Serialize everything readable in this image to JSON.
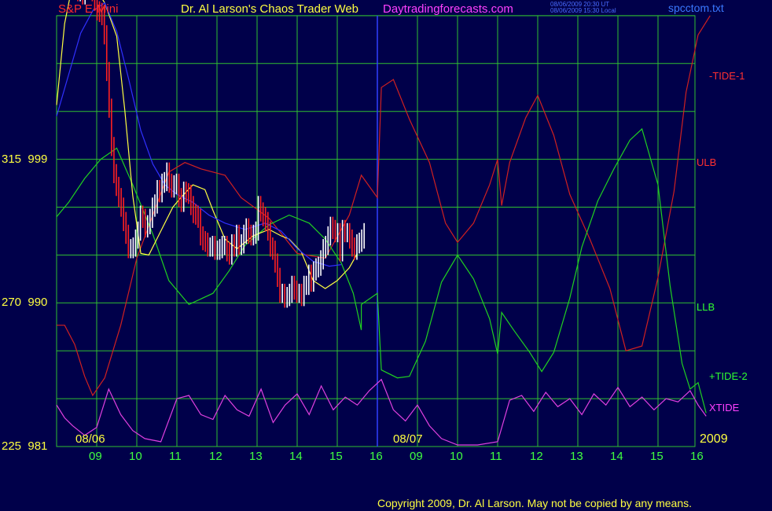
{
  "header": {
    "instrument": "S&P E-Mini",
    "title": "Dr. Al Larson's Chaos Trader Web",
    "site": "Daytradingforecasts.com",
    "timestamp_ut": "08/06/2009 20:30 UT",
    "timestamp_local": "08/06/2009 15:30 Local",
    "file": "spcctom.txt"
  },
  "footer": {
    "copyright": "Copyright 2009, Dr. Al Larson. May not be copied by any means.",
    "year": "2009"
  },
  "chart_data": {
    "type": "line",
    "y_axis_labels": [
      {
        "pct": "315",
        "price": "999"
      },
      {
        "pct": "270",
        "price": "990"
      },
      {
        "pct": "225",
        "price": "981"
      }
    ],
    "ylim": [
      981,
      1014
    ],
    "x_ticks": [
      "09",
      "10",
      "11",
      "12",
      "13",
      "14",
      "15",
      "16",
      "09",
      "10",
      "11",
      "12",
      "13",
      "14",
      "15",
      "16"
    ],
    "dates": [
      "08/06",
      "08/07"
    ],
    "grid": true,
    "legend": {
      "tide1": "-TIDE-1",
      "ulb": "ULB",
      "llb": "LLB",
      "tide2": "+TIDE-2",
      "xtide": "XTIDE"
    },
    "colors": {
      "background": "#00004a",
      "grid": "#30c030",
      "price_up": "#ffffff",
      "price_down": "#ff2020",
      "ulb": "#d02020",
      "llb": "#20d020",
      "ma_fast": "#ffff40",
      "ma_slow": "#3030ff",
      "xtide": "#e040e0",
      "text": "#ffff40"
    },
    "series": [
      {
        "name": "ULB",
        "values": [
          [
            0,
            988.6
          ],
          [
            0.2,
            988.6
          ],
          [
            0.45,
            987.4
          ],
          [
            0.7,
            985.4
          ],
          [
            0.9,
            984.2
          ],
          [
            1.2,
            985.3
          ],
          [
            1.6,
            988.6
          ],
          [
            2,
            992.8
          ],
          [
            2.4,
            995.5
          ],
          [
            2.8,
            998.2
          ],
          [
            3.2,
            998.8
          ],
          [
            3.6,
            998.4
          ],
          [
            4.2,
            998.0
          ],
          [
            4.6,
            996.6
          ],
          [
            5.3,
            995.3
          ],
          [
            6,
            993.1
          ],
          [
            6.7,
            992.8
          ],
          [
            7.3,
            995.5
          ],
          [
            7.6,
            998.0
          ],
          [
            8,
            996.6
          ],
          [
            8.1,
            1003.5
          ],
          [
            8.4,
            1004.0
          ],
          [
            8.8,
            1001.5
          ],
          [
            9.3,
            998.8
          ],
          [
            9.7,
            995.0
          ],
          [
            10,
            993.8
          ],
          [
            10.4,
            995.0
          ],
          [
            10.8,
            997.4
          ],
          [
            11,
            999.0
          ],
          [
            11.1,
            996.1
          ],
          [
            11.3,
            998.8
          ],
          [
            11.7,
            1001.6
          ],
          [
            12,
            1003.0
          ],
          [
            12.4,
            1000.5
          ],
          [
            12.8,
            996.8
          ],
          [
            13.3,
            994.0
          ],
          [
            13.8,
            990.9
          ],
          [
            14.2,
            987.0
          ],
          [
            14.6,
            987.3
          ],
          [
            15,
            991.6
          ],
          [
            15.4,
            997.0
          ],
          [
            15.7,
            1003.2
          ],
          [
            16,
            1006.8
          ],
          [
            16.3,
            1008.0
          ]
        ]
      },
      {
        "name": "LLB",
        "values": [
          [
            0,
            995.4
          ],
          [
            0.3,
            996.3
          ],
          [
            0.7,
            997.8
          ],
          [
            1.1,
            999.0
          ],
          [
            1.5,
            999.7
          ],
          [
            1.9,
            997.4
          ],
          [
            2.4,
            994.3
          ],
          [
            2.8,
            991.4
          ],
          [
            3.3,
            989.9
          ],
          [
            3.9,
            990.6
          ],
          [
            4.3,
            992.0
          ],
          [
            4.7,
            993.6
          ],
          [
            5.3,
            994.9
          ],
          [
            5.8,
            995.5
          ],
          [
            6.3,
            995.0
          ],
          [
            6.7,
            994.0
          ],
          [
            7.1,
            992.5
          ],
          [
            7.4,
            990.6
          ],
          [
            7.6,
            988.3
          ],
          [
            7.6,
            989.9
          ],
          [
            8,
            990.6
          ],
          [
            8.1,
            985.8
          ],
          [
            8.5,
            985.3
          ],
          [
            8.8,
            985.4
          ],
          [
            9.2,
            987.6
          ],
          [
            9.6,
            991.3
          ],
          [
            10,
            993.0
          ],
          [
            10.4,
            991.5
          ],
          [
            10.8,
            989.0
          ],
          [
            11,
            986.8
          ],
          [
            11.1,
            989.4
          ],
          [
            11.4,
            988.3
          ],
          [
            11.8,
            986.9
          ],
          [
            12.1,
            985.7
          ],
          [
            12.4,
            986.9
          ],
          [
            12.8,
            990.3
          ],
          [
            13.1,
            993.5
          ],
          [
            13.5,
            996.4
          ],
          [
            13.9,
            998.4
          ],
          [
            14.3,
            1000.2
          ],
          [
            14.6,
            1000.9
          ],
          [
            15,
            997.4
          ],
          [
            15.3,
            991.1
          ],
          [
            15.6,
            986.2
          ],
          [
            15.8,
            984.6
          ],
          [
            16,
            985.0
          ],
          [
            16.2,
            983.1
          ]
        ]
      },
      {
        "name": "XTIDE",
        "values": [
          [
            0,
            983.6
          ],
          [
            0.2,
            982.8
          ],
          [
            0.4,
            982.3
          ],
          [
            0.7,
            981.7
          ],
          [
            1,
            982.2
          ],
          [
            1.3,
            984.6
          ],
          [
            1.6,
            983.0
          ],
          [
            1.9,
            982.0
          ],
          [
            2.2,
            981.5
          ],
          [
            2.6,
            981.3
          ],
          [
            3,
            984.0
          ],
          [
            3.3,
            984.2
          ],
          [
            3.6,
            983.0
          ],
          [
            3.9,
            982.7
          ],
          [
            4.2,
            984.2
          ],
          [
            4.5,
            983.3
          ],
          [
            4.8,
            982.9
          ],
          [
            5.1,
            984.6
          ],
          [
            5.4,
            982.5
          ],
          [
            5.7,
            983.6
          ],
          [
            6,
            984.3
          ],
          [
            6.3,
            983.0
          ],
          [
            6.6,
            984.8
          ],
          [
            6.9,
            983.3
          ],
          [
            7.2,
            984.1
          ],
          [
            7.5,
            983.6
          ],
          [
            7.8,
            984.5
          ],
          [
            8.1,
            985.2
          ],
          [
            8.4,
            983.3
          ],
          [
            8.7,
            982.6
          ],
          [
            9,
            983.6
          ],
          [
            9.3,
            982.3
          ],
          [
            9.6,
            981.5
          ],
          [
            10,
            981.1
          ],
          [
            10.5,
            981.1
          ],
          [
            11,
            981.3
          ],
          [
            11.3,
            983.9
          ],
          [
            11.6,
            984.2
          ],
          [
            11.9,
            983.2
          ],
          [
            12.2,
            984.4
          ],
          [
            12.5,
            983.5
          ],
          [
            12.8,
            984.0
          ],
          [
            13.1,
            983.0
          ],
          [
            13.4,
            984.3
          ],
          [
            13.7,
            983.6
          ],
          [
            14,
            984.7
          ],
          [
            14.3,
            983.5
          ],
          [
            14.6,
            984.1
          ],
          [
            14.9,
            983.3
          ],
          [
            15.2,
            984.0
          ],
          [
            15.5,
            983.8
          ],
          [
            15.8,
            984.5
          ],
          [
            16,
            983.6
          ],
          [
            16.2,
            982.9
          ]
        ]
      },
      {
        "name": "fast-average",
        "values": [
          [
            0,
            1002.4
          ],
          [
            0.2,
            1007.5
          ],
          [
            0.4,
            1010.0
          ],
          [
            0.6,
            1010.7
          ],
          [
            0.9,
            1010.0
          ],
          [
            1.2,
            1008.8
          ],
          [
            1.5,
            1006.7
          ],
          [
            1.7,
            1002.1
          ],
          [
            1.9,
            996.7
          ],
          [
            2.1,
            993.1
          ],
          [
            2.3,
            993.0
          ],
          [
            2.6,
            994.5
          ],
          [
            2.9,
            996.0
          ],
          [
            3.1,
            996.6
          ],
          [
            3.4,
            997.4
          ],
          [
            3.7,
            997.1
          ],
          [
            3.9,
            995.8
          ],
          [
            4.2,
            994.0
          ],
          [
            4.5,
            993.4
          ],
          [
            4.9,
            994.2
          ],
          [
            5.3,
            994.6
          ],
          [
            5.6,
            994.2
          ],
          [
            5.8,
            994.0
          ],
          [
            6.1,
            993.2
          ],
          [
            6.4,
            991.4
          ],
          [
            6.7,
            990.9
          ],
          [
            7,
            991.4
          ],
          [
            7.3,
            992.2
          ],
          [
            7.5,
            993.1
          ]
        ]
      },
      {
        "name": "slow-average",
        "values": [
          [
            0,
            1001.7
          ],
          [
            0.3,
            1004.3
          ],
          [
            0.6,
            1006.9
          ],
          [
            0.9,
            1008.3
          ],
          [
            1.2,
            1008.8
          ],
          [
            1.5,
            1007.0
          ],
          [
            1.8,
            1004.0
          ],
          [
            2.1,
            1000.8
          ],
          [
            2.4,
            998.7
          ],
          [
            2.7,
            997.4
          ],
          [
            3,
            996.8
          ],
          [
            3.4,
            996.3
          ],
          [
            3.8,
            995.5
          ],
          [
            4.2,
            995.0
          ],
          [
            4.7,
            994.6
          ],
          [
            5.2,
            995.0
          ],
          [
            5.6,
            994.5
          ],
          [
            6,
            993.4
          ],
          [
            6.4,
            992.6
          ],
          [
            6.8,
            992.3
          ],
          [
            7.1,
            992.4
          ]
        ]
      }
    ],
    "price_bars": {
      "x_start": 0.05,
      "x_step": 0.06,
      "values": [
        1010.2,
        1010.4,
        1011.5,
        1011.9,
        1011.1,
        1010.0,
        1010.0,
        1010.1,
        1009.5,
        1009.8,
        1009.3,
        1009.9,
        1009.8,
        1010.0,
        1009.5,
        1008.9,
        1008.3,
        1008.2,
        1008.0,
        1006.8,
        1004.5,
        1002.2,
        999.8,
        998.1,
        997.3,
        996.6,
        996.0,
        995.1,
        994.3,
        993.4,
        993.4,
        993.5,
        994.0,
        994.5,
        995.5,
        995.3,
        994.7,
        994.9,
        995.3,
        996.0,
        996.2,
        997.1,
        996.9,
        997.5,
        997.6,
        998.2,
        997.5,
        997.2,
        997.4,
        997.5,
        996.6,
        996.3,
        997.0,
        996.9,
        996.8,
        996.1,
        995.6,
        995.5,
        995.3,
        994.2,
        993.9,
        993.8,
        993.5,
        993.5,
        993.6,
        993.3,
        993.3,
        993.4,
        993.6,
        993.6,
        993.2,
        993.0,
        993.7,
        993.5,
        994.3,
        993.6,
        993.7,
        994.3,
        994.7,
        994.3,
        994.2,
        994.3,
        994.5,
        996.1,
        995.7,
        995.4,
        995.1,
        994.5,
        993.5,
        993.3,
        992.5,
        991.6,
        990.6,
        990.6,
        990.3,
        990.4,
        990.6,
        991.1,
        990.8,
        990.6,
        990.6,
        990.4,
        991.1,
        991.1,
        991.8,
        991.3,
        992.0,
        992.2,
        992.3,
        992.7,
        993.4,
        993.6,
        994.2,
        994.8,
        994.6,
        994.4,
        994.4,
        993.2,
        994.6,
        994.4,
        994.4,
        994.0,
        993.5,
        993.3,
        993.7,
        993.8,
        994.0,
        994.4
      ]
    }
  }
}
